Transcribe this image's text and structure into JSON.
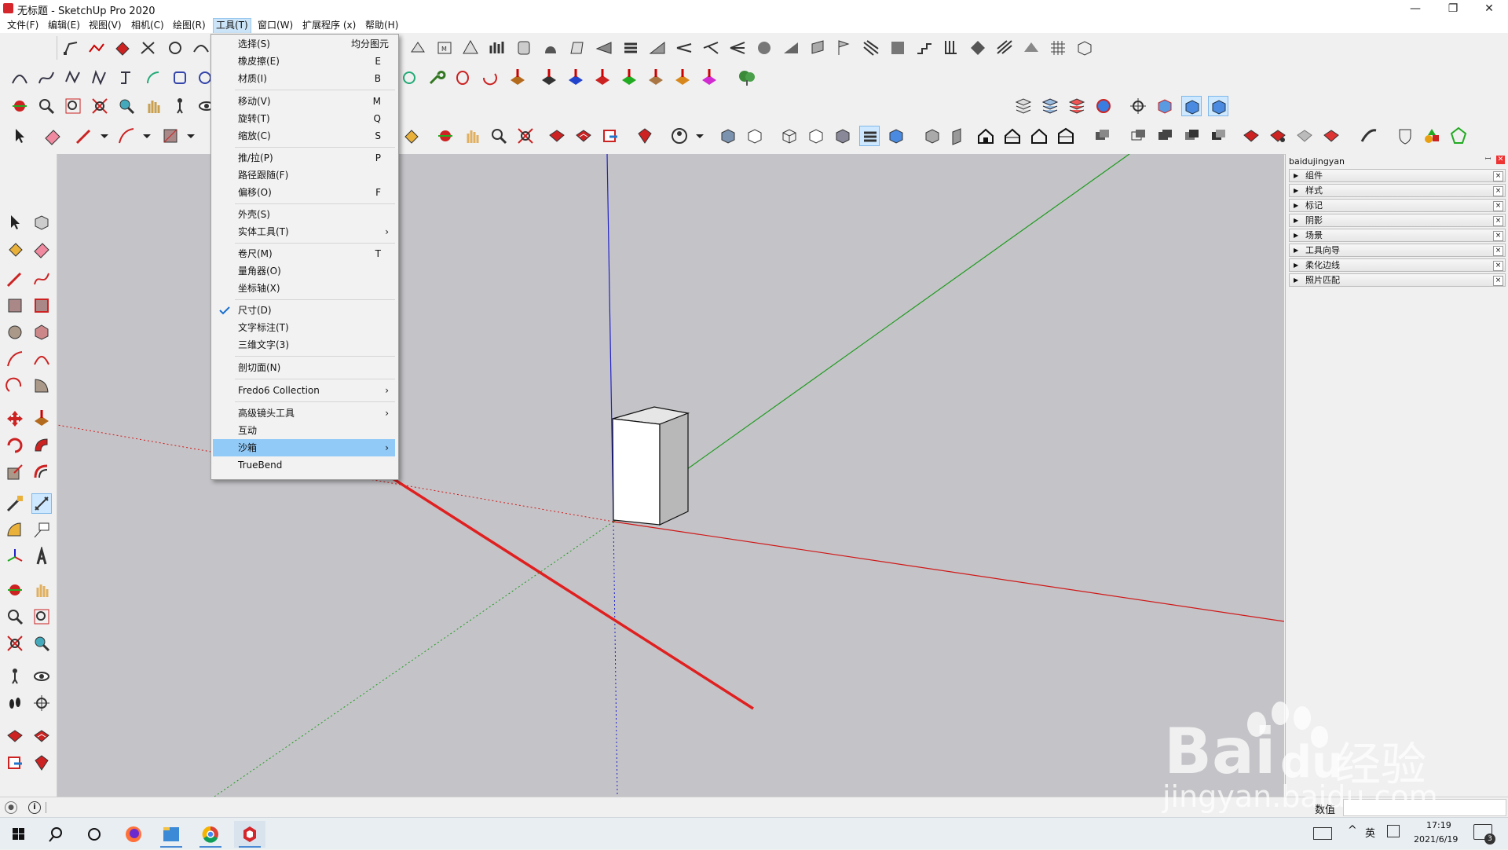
{
  "window": {
    "title": "无标题 - SketchUp Pro 2020",
    "min": "—",
    "max": "❐",
    "close": "✕"
  },
  "menubar": [
    "文件(F)",
    "编辑(E)",
    "视图(V)",
    "相机(C)",
    "绘图(R)",
    "工具(T)",
    "窗口(W)",
    "扩展程序 (x)",
    "帮助(H)"
  ],
  "active_menu": "工具(T)",
  "tools_menu": {
    "items": [
      {
        "label": "选择(S)",
        "key": "均分图元"
      },
      {
        "label": "橡皮擦(E)",
        "key": "E"
      },
      {
        "label": "材质(I)",
        "key": "B"
      },
      {
        "label": "移动(V)",
        "key": "M"
      },
      {
        "label": "旋转(T)",
        "key": "Q"
      },
      {
        "label": "缩放(C)",
        "key": "S"
      },
      {
        "label": "推/拉(P)",
        "key": "P"
      },
      {
        "label": "路径跟随(F)",
        "key": ""
      },
      {
        "label": "偏移(O)",
        "key": "F"
      },
      {
        "label": "外壳(S)",
        "key": ""
      },
      {
        "label": "实体工具(T)",
        "key": "",
        "submenu": "›"
      },
      {
        "label": "卷尺(M)",
        "key": "T"
      },
      {
        "label": "量角器(O)",
        "key": ""
      },
      {
        "label": "坐标轴(X)",
        "key": ""
      },
      {
        "label": "尺寸(D)",
        "key": "",
        "checked": true
      },
      {
        "label": "文字标注(T)",
        "key": ""
      },
      {
        "label": "三维文字(3)",
        "key": ""
      },
      {
        "label": "剖切面(N)",
        "key": ""
      },
      {
        "label": "Fredo6 Collection",
        "key": "",
        "submenu": "›"
      },
      {
        "label": "高级镜头工具",
        "key": "",
        "submenu": "›"
      },
      {
        "label": "互动",
        "key": ""
      },
      {
        "label": "沙箱",
        "key": "",
        "submenu": "›",
        "highlighted": true
      },
      {
        "label": "TrueBend",
        "key": ""
      }
    ]
  },
  "tray": {
    "title": "baidujingyan",
    "pin": "ꟷ",
    "close": "✕",
    "panels": [
      "组件",
      "样式",
      "标记",
      "阴影",
      "场景",
      "工具向导",
      "柔化边线",
      "照片匹配"
    ]
  },
  "status": {
    "measurement_label": "数值"
  },
  "taskbar": {
    "time": "17:19",
    "date": "2021/6/19",
    "ime": "英",
    "notifications": "3",
    "tray_caret": "^"
  },
  "watermark": {
    "brand": "Bai",
    "brand2": "du",
    "cn": "经验",
    "url": "jingyan.baidu.com"
  },
  "colors": {
    "axis_red": "#d01818",
    "axis_green": "#1f9a1f",
    "axis_blue": "#2020c8",
    "annotation_arrow": "#e02020",
    "menu_highlight": "#91c9f7",
    "viewport_bg": "#c4c4c8"
  }
}
